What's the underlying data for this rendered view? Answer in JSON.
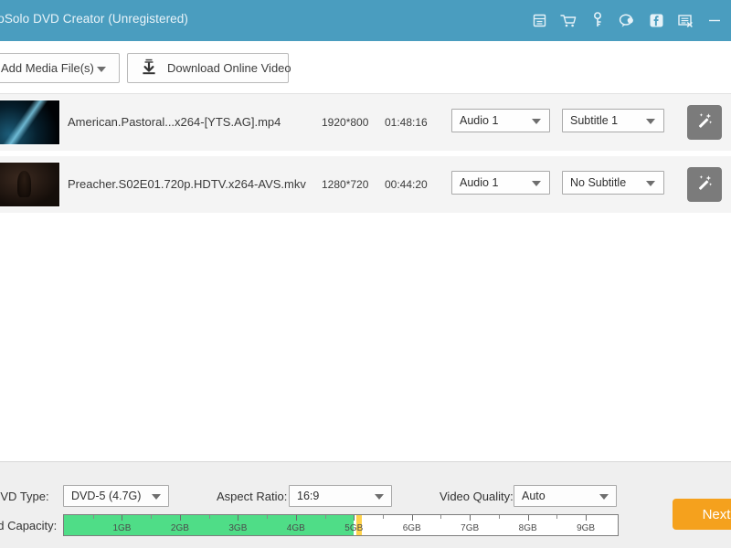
{
  "window": {
    "title": "deoSolo DVD Creator (Unregistered)",
    "titlebar_color": "#4a9dbf",
    "accent_color": "#f5a11d"
  },
  "titlebar_icons": [
    {
      "name": "register-icon",
      "glyph": "register"
    },
    {
      "name": "cart-icon",
      "glyph": "cart"
    },
    {
      "name": "key-icon",
      "glyph": "key"
    },
    {
      "name": "feedback-icon",
      "glyph": "feedback"
    },
    {
      "name": "facebook-icon",
      "glyph": "facebook"
    },
    {
      "name": "notes-icon",
      "glyph": "notes"
    },
    {
      "name": "minimize-icon",
      "glyph": "minimize"
    }
  ],
  "toolbar": {
    "add_media_label": "Add Media File(s)",
    "download_label": "Download Online Video"
  },
  "files": [
    {
      "name": "American.Pastoral...x264-[YTS.AG].mp4",
      "resolution": "1920*800",
      "duration": "01:48:16",
      "audio": "Audio 1",
      "subtitle": "Subtitle 1",
      "edit_label": "magic-wand"
    },
    {
      "name": "Preacher.S02E01.720p.HDTV.x264-AVS.mkv",
      "resolution": "1280*720",
      "duration": "00:44:20",
      "audio": "Audio 1",
      "subtitle": "No Subtitle",
      "edit_label": "magic-wand"
    }
  ],
  "settings": {
    "dvd_type_label": "DVD Type:",
    "dvd_type_value": "DVD-5 (4.7G)",
    "aspect_label": "Aspect Ratio:",
    "aspect_value": "16:9",
    "quality_label": "Video Quality:",
    "quality_value": "Auto"
  },
  "capacity": {
    "label": "ed Capacity:",
    "used_gb": 5.0,
    "marker_gb": 5.05,
    "max_gb": 9.55,
    "fill_color": "#4fdd87",
    "marker_color": "#ffd24a",
    "ticks": [
      "1GB",
      "2GB",
      "3GB",
      "4GB",
      "5GB",
      "6GB",
      "7GB",
      "8GB",
      "9GB"
    ]
  },
  "footer": {
    "next_label": "Next"
  }
}
